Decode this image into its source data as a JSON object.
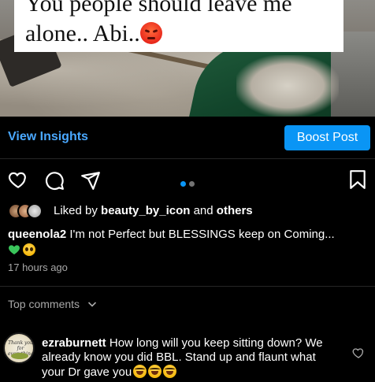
{
  "photo": {
    "caption_line1": "You people should leave me",
    "caption_line2": "alone.. Abi..",
    "caption_emoji": "angry-face-emoji"
  },
  "insights": {
    "view_label": "View Insights",
    "boost_label": "Boost Post",
    "accent_color": "#0a95f5"
  },
  "actions": {
    "icons": [
      "heart-icon",
      "comment-icon",
      "share-icon",
      "bookmark-icon"
    ],
    "carousel_position": "1 of 2"
  },
  "likes": {
    "prefix": "Liked by",
    "user": "beauty_by_icon",
    "connector": "and",
    "suffix": "others"
  },
  "post": {
    "username": "queenola2",
    "text": "I'm not Perfect but BLESSINGS keep on Coming...",
    "emojis": [
      "green-heart-emoji",
      "pleading-face-emoji"
    ],
    "time": "17 hours ago"
  },
  "comments": {
    "header": "Top comments",
    "items": [
      {
        "username": "ezraburnett",
        "text": "How long will you keep sitting down? We already know you did BBL. Stand up and flaunt what your Dr gave you",
        "emojis": [
          "laughing-emoji",
          "laughing-emoji",
          "laughing-emoji"
        ],
        "avatar_text": "Thank you for everything!"
      }
    ]
  }
}
